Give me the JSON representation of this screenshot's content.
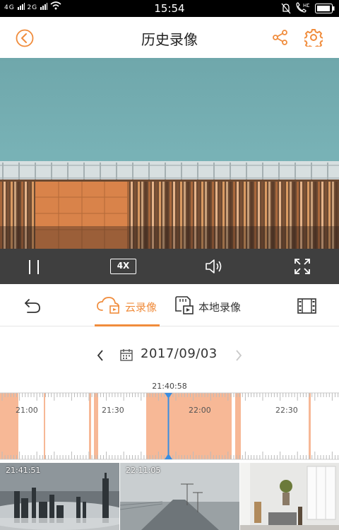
{
  "status_bar": {
    "network_left": "4G",
    "network_mid": "2G",
    "time": "15:54"
  },
  "header": {
    "title": "历史录像"
  },
  "controls": {
    "speed": "4X"
  },
  "tabs": [
    {
      "label": "云录像",
      "active": true
    },
    {
      "label": "本地录像",
      "active": false
    }
  ],
  "date_nav": {
    "date": "2017/09/03"
  },
  "timeline": {
    "cursor_time": "21:40:58",
    "labels": [
      "21:00",
      "21:30",
      "22:00",
      "22:30"
    ]
  },
  "thumbnails": [
    {
      "timestamp": "21:41:51"
    },
    {
      "timestamp": "22:11:05"
    },
    {
      "timestamp": ""
    }
  ],
  "colors": {
    "accent": "#f08c3c",
    "recording": "#f7b896",
    "cursor": "#3a8de0",
    "control_bar": "#3f3f3f"
  }
}
